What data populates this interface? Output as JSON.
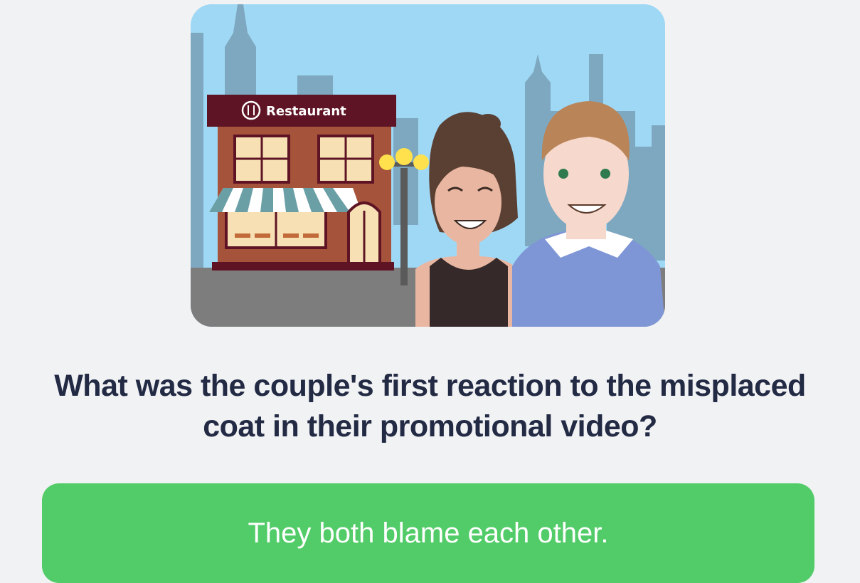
{
  "illustration": {
    "sign_text": "Restaurant",
    "colors": {
      "sky": "#9fd8f5",
      "skyline": "#7ea8c0",
      "ground": "#7d7d7d",
      "building": "#a6533b",
      "sign": "#5e1424",
      "awning_stripe": "#6b9fa6",
      "window": "#f6e0b4",
      "woman_top": "#35292a",
      "man_sweater": "#7f96d6"
    }
  },
  "question": {
    "text": "What was the couple's first reaction to the misplaced coat in their promotional video?"
  },
  "answers": [
    {
      "label": "They both blame each other.",
      "color": "#52cc68"
    }
  ]
}
